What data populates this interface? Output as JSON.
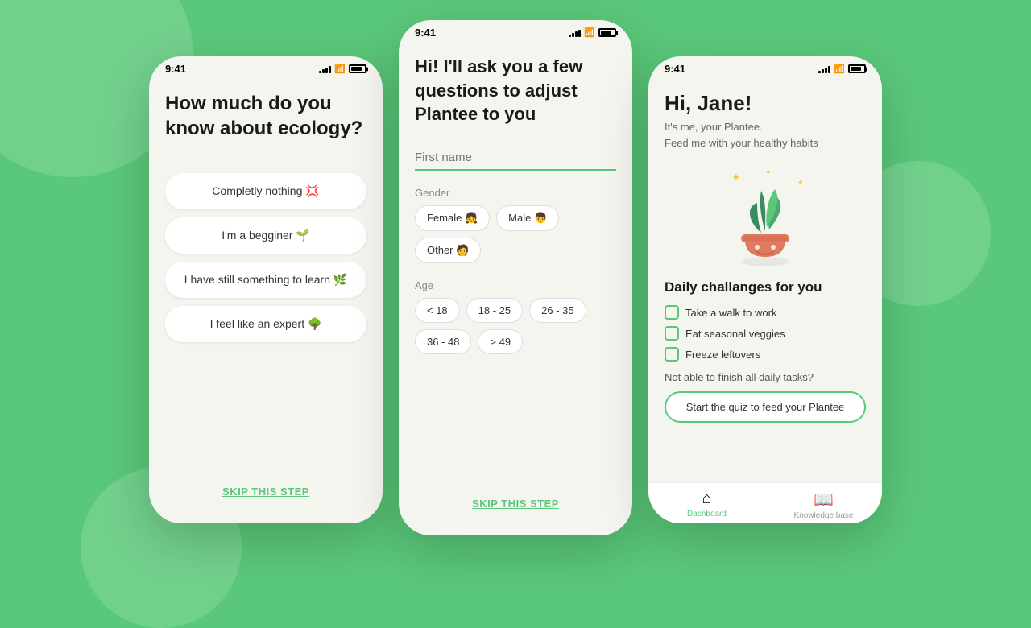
{
  "background": {
    "color": "#5ac87a"
  },
  "phone_left": {
    "status_time": "9:41",
    "title": "How much do you know about ecology?",
    "answers": [
      {
        "label": "Completly nothing 💢",
        "emoji": "💢"
      },
      {
        "label": "I'm a begginer 🌱",
        "emoji": "🌱"
      },
      {
        "label": "I have still something to learn 🌿",
        "emoji": "🌿"
      },
      {
        "label": "I feel like an expert 🌳",
        "emoji": "🌳"
      }
    ],
    "skip_label": "SKIP THIS STEP"
  },
  "phone_center": {
    "status_time": "9:41",
    "title": "Hi! I'll ask you a few questions to adjust Plantee to you",
    "first_name_placeholder": "First name",
    "gender_label": "Gender",
    "gender_options": [
      {
        "label": "Female",
        "emoji": "👧"
      },
      {
        "label": "Male",
        "emoji": "👦"
      },
      {
        "label": "Other",
        "emoji": "🧑"
      }
    ],
    "age_label": "Age",
    "age_options": [
      "< 18",
      "18 - 25",
      "26 - 35",
      "36 - 48",
      "> 49"
    ],
    "skip_label": "SKIP THIS STEP"
  },
  "phone_right": {
    "status_time": "9:41",
    "greeting": "Hi, Jane!",
    "subtitle_line1": "It's me, your Plantee.",
    "subtitle_line2": "Feed me with your healthy habits",
    "daily_title": "Daily challanges for you",
    "tasks": [
      "Take a walk to work",
      "Eat seasonal veggies",
      "Freeze leftovers"
    ],
    "quiz_prompt": "Not able to finish all daily tasks?",
    "quiz_button": "Start the quiz to feed your Plantee",
    "nav_items": [
      {
        "label": "Dashboard",
        "active": true
      },
      {
        "label": "Knowledge base",
        "active": false
      }
    ]
  },
  "colors": {
    "green_accent": "#5ac87a",
    "chip_border": "#ddd",
    "text_dark": "#1a1a1a",
    "text_muted": "#888"
  }
}
